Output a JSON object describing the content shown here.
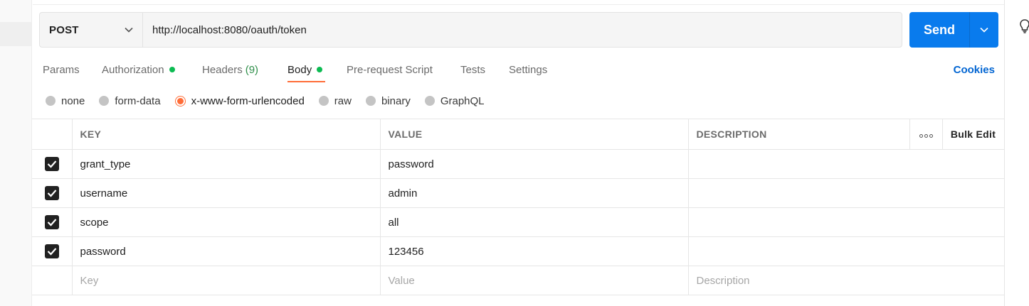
{
  "request": {
    "method": "POST",
    "url": "http://localhost:8080/oauth/token",
    "send_label": "Send"
  },
  "tabs": [
    {
      "label": "Params"
    },
    {
      "label": "Authorization"
    },
    {
      "label": "Headers",
      "count": "(9)"
    },
    {
      "label": "Body"
    },
    {
      "label": "Pre-request Script"
    },
    {
      "label": "Tests"
    },
    {
      "label": "Settings"
    }
  ],
  "active_tab": "Body",
  "cookies_label": "Cookies",
  "body_types": [
    {
      "label": "none"
    },
    {
      "label": "form-data"
    },
    {
      "label": "x-www-form-urlencoded"
    },
    {
      "label": "raw"
    },
    {
      "label": "binary"
    },
    {
      "label": "GraphQL"
    }
  ],
  "selected_body_type": "x-www-form-urlencoded",
  "table": {
    "headers": {
      "key": "KEY",
      "value": "VALUE",
      "description": "DESCRIPTION",
      "bulk_edit": "Bulk Edit"
    },
    "rows": [
      {
        "checked": true,
        "key": "grant_type",
        "value": "password",
        "description": ""
      },
      {
        "checked": true,
        "key": "username",
        "value": "admin",
        "description": ""
      },
      {
        "checked": true,
        "key": "scope",
        "value": "all",
        "description": ""
      },
      {
        "checked": true,
        "key": "password",
        "value": "123456",
        "description": ""
      }
    ],
    "placeholders": {
      "key": "Key",
      "value": "Value",
      "description": "Description"
    }
  },
  "colors": {
    "accent": "#ff6c37",
    "send": "#097bed",
    "status_dot": "#0cbb52",
    "link": "#0265d2"
  },
  "icons": [
    "chevron-down-icon",
    "lightbulb-icon",
    "more-dots-icon",
    "checkbox-checked-icon"
  ]
}
